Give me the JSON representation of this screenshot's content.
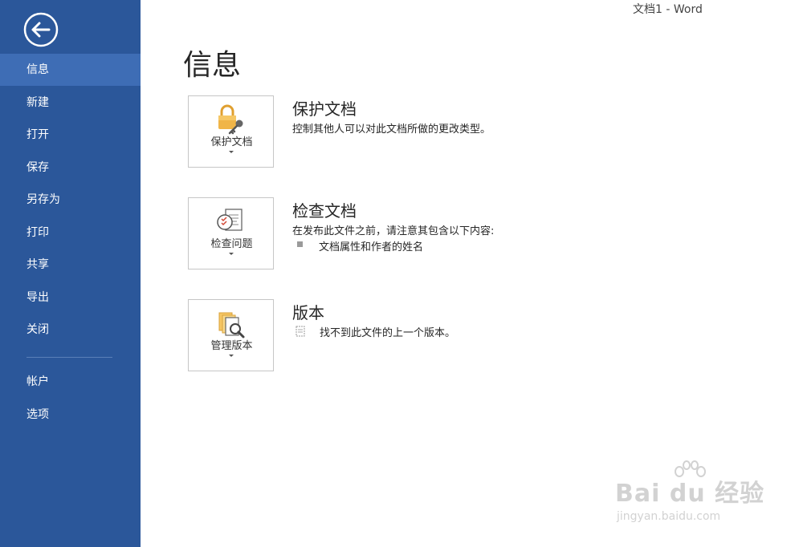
{
  "window": {
    "title": "文档1 - Word"
  },
  "sidebar": {
    "items": [
      {
        "label": "信息",
        "active": true
      },
      {
        "label": "新建"
      },
      {
        "label": "打开"
      },
      {
        "label": "保存"
      },
      {
        "label": "另存为"
      },
      {
        "label": "打印"
      },
      {
        "label": "共享"
      },
      {
        "label": "导出"
      },
      {
        "label": "关闭"
      }
    ],
    "bottom_items": [
      {
        "label": "帐户"
      },
      {
        "label": "选项"
      }
    ],
    "back_icon": "back-arrow-icon"
  },
  "main": {
    "title": "信息",
    "sections": [
      {
        "button_label": "保护文档",
        "heading": "保护文档",
        "description": "控制其他人可以对此文档所做的更改类型。",
        "icon": "lock-key-icon"
      },
      {
        "button_label": "检查问题",
        "heading": "检查文档",
        "description": "在发布此文件之前，请注意其包含以下内容:",
        "bullet": "文档属性和作者的姓名",
        "icon": "inspect-document-icon"
      },
      {
        "button_label": "管理版本",
        "heading": "版本",
        "description": "找不到此文件的上一个版本。",
        "icon": "manage-versions-icon"
      }
    ]
  },
  "watermark": {
    "main": "Bai du 经验",
    "sub": "jingyan.baidu.com"
  },
  "colors": {
    "sidebar": "#2b579a",
    "sidebar_active": "#3e6db5",
    "accent_orange": "#e8a33d"
  }
}
